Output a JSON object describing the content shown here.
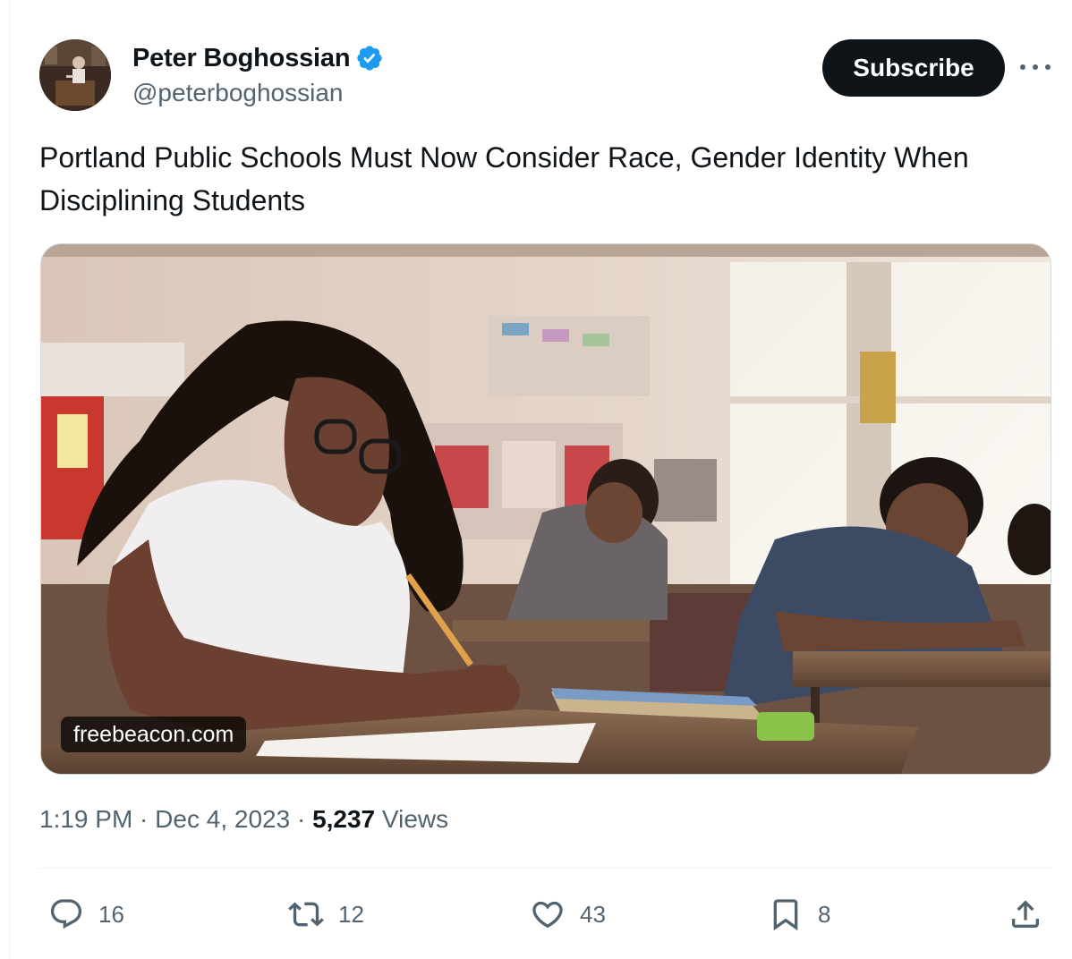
{
  "author": {
    "display_name": "Peter Boghossian",
    "handle": "@peterboghossian",
    "verified": true,
    "avatar_icon": "profile-photo"
  },
  "header": {
    "subscribe_label": "Subscribe",
    "more_icon": "ellipsis-icon"
  },
  "tweet": {
    "text": "Portland Public Schools Must Now Consider Race, Gender Identity When Disciplining Students"
  },
  "media": {
    "domain": "freebeacon.com"
  },
  "meta": {
    "time": "1:19 PM",
    "separator": " · ",
    "date": "Dec 4, 2023",
    "views_count": "5,237",
    "views_label": "Views"
  },
  "actions": {
    "replies": "16",
    "reposts": "12",
    "likes": "43",
    "bookmarks": "8",
    "icons": [
      "reply-icon",
      "repost-icon",
      "like-icon",
      "bookmark-icon",
      "share-icon"
    ]
  },
  "colors": {
    "text": "#0f1419",
    "secondary": "#536471",
    "verified": "#1d9bf0",
    "divider": "#eff3f4"
  }
}
